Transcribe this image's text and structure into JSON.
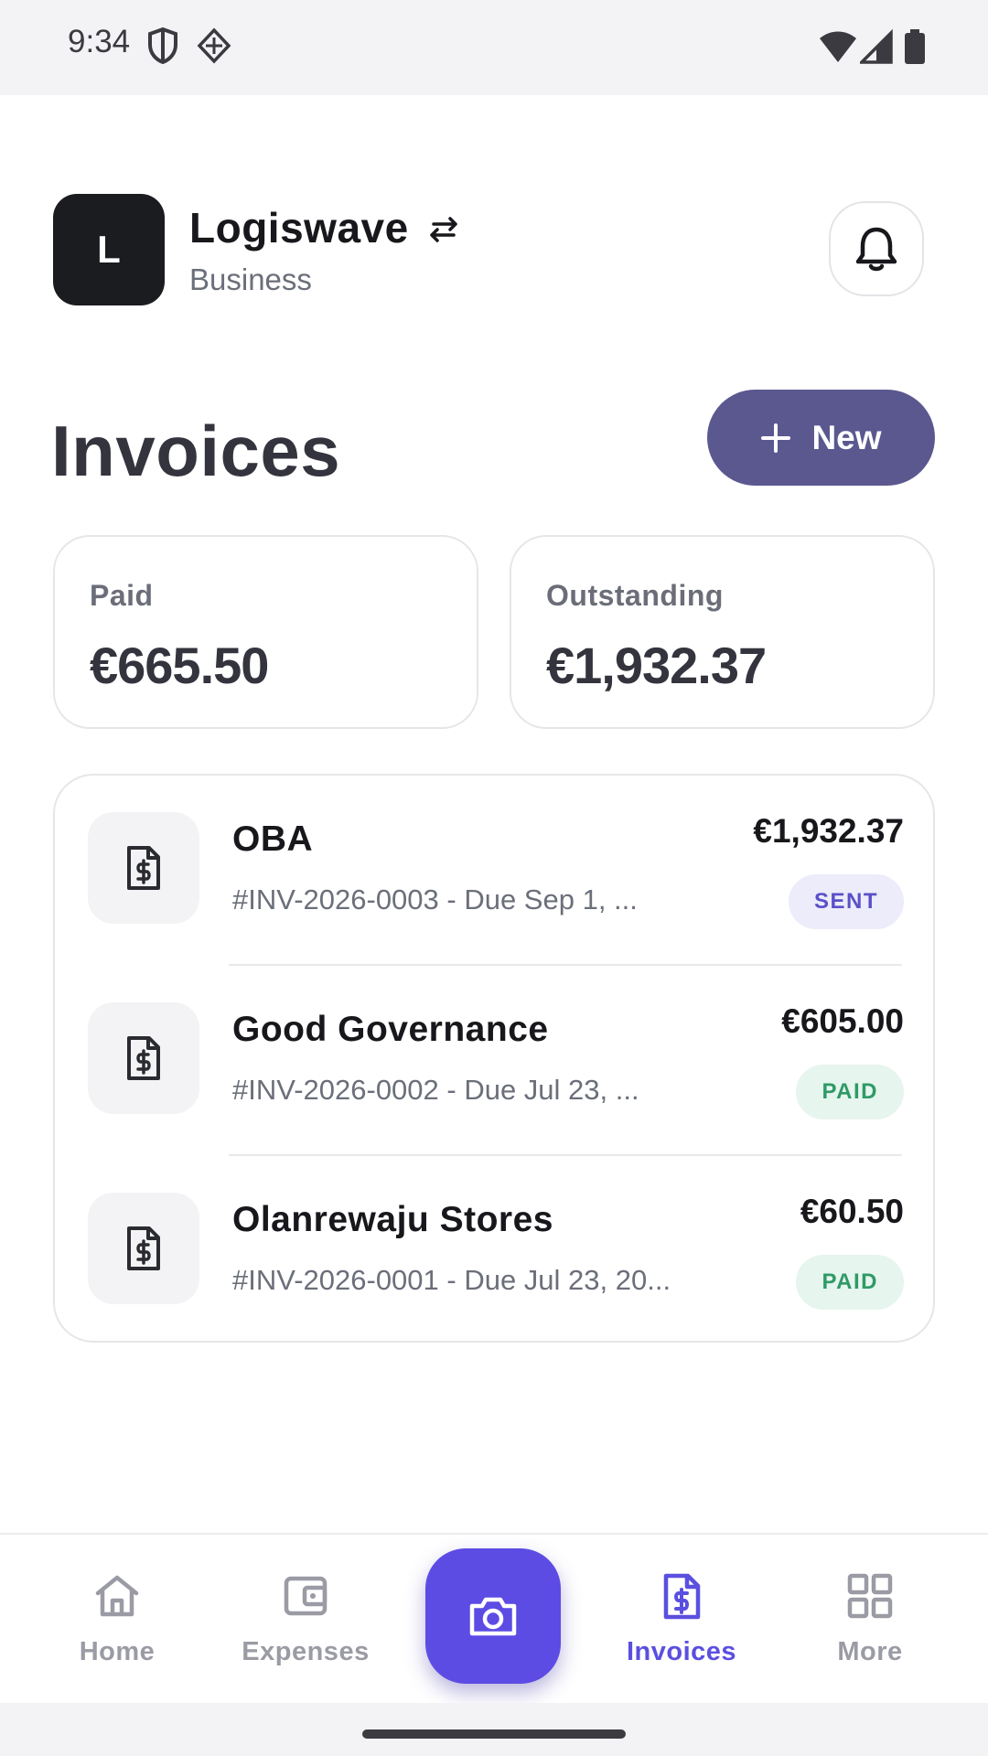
{
  "status_bar": {
    "time": "9:34"
  },
  "header": {
    "avatar_letter": "L",
    "org_name": "Logiswave",
    "org_type": "Business"
  },
  "page": {
    "title": "Invoices",
    "new_button_label": "New"
  },
  "stats": [
    {
      "label": "Paid",
      "value": "€665.50"
    },
    {
      "label": "Outstanding",
      "value": "€1,932.37"
    }
  ],
  "invoices": [
    {
      "client": "OBA",
      "meta": "#INV-2026-0003 - Due Sep 1, ...",
      "amount": "€1,932.37",
      "status": "SENT"
    },
    {
      "client": "Good Governance",
      "meta": "#INV-2026-0002 - Due Jul 23, ...",
      "amount": "€605.00",
      "status": "PAID"
    },
    {
      "client": "Olanrewaju Stores",
      "meta": "#INV-2026-0001 - Due Jul 23, 20...",
      "amount": "€60.50",
      "status": "PAID"
    }
  ],
  "nav": {
    "items": [
      {
        "label": "Home",
        "icon": "home-icon"
      },
      {
        "label": "Expenses",
        "icon": "wallet-icon"
      },
      {
        "label": "Invoices",
        "icon": "invoice-icon",
        "active": true
      },
      {
        "label": "More",
        "icon": "grid-icon"
      }
    ],
    "center_action_icon": "camera-icon"
  },
  "colors": {
    "accent": "#5c4ce4",
    "new_button": "#5b5890",
    "sent_badge_text": "#5a50c8",
    "paid_badge_text": "#2f9a66"
  }
}
